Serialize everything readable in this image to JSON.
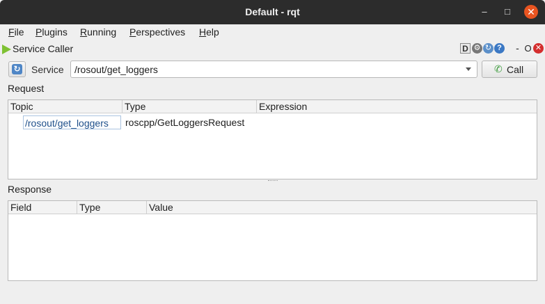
{
  "window": {
    "title": "Default - rqt",
    "minimize": "–",
    "maximize": "□",
    "close": "✕"
  },
  "menubar": [
    {
      "u": "F",
      "rest": "ile"
    },
    {
      "u": "P",
      "rest": "lugins"
    },
    {
      "u": "R",
      "rest": "unning"
    },
    {
      "u": "P",
      "rest": "erspectives"
    },
    {
      "u": "H",
      "rest": "elp"
    }
  ],
  "plugin": {
    "title": "Service Caller",
    "d_label": "D",
    "dash": "-",
    "float": "O",
    "close": "✕",
    "help": "?"
  },
  "service": {
    "label": "Service",
    "value": "/rosout/get_loggers",
    "call_label": "Call"
  },
  "request": {
    "label": "Request",
    "columns": [
      "Topic",
      "Type",
      "Expression"
    ],
    "rows": [
      {
        "topic": "/rosout/get_loggers",
        "type": "roscpp/GetLoggersRequest",
        "expression": ""
      }
    ]
  },
  "response": {
    "label": "Response",
    "columns": [
      "Field",
      "Type",
      "Value"
    ]
  }
}
